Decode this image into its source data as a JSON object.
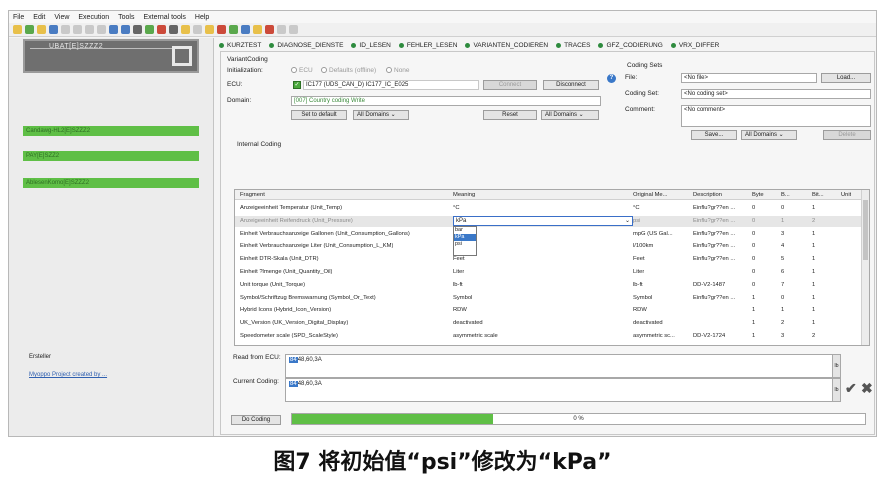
{
  "menu": [
    "File",
    "Edit",
    "View",
    "Execution",
    "Tools",
    "External tools",
    "Help"
  ],
  "left": {
    "ubat_label": "UBAT[E]SZZZ2",
    "green_bars": [
      "Candawg-HL2[E]SZZZ2",
      "PAY[E]SZZ2",
      "AblesenKomo[E]SZZZ2"
    ],
    "ersteller_label": "Ersteller",
    "ersteller_link": "Myoppo Project created by ..."
  },
  "tabs": [
    "KURZTEST",
    "DIAGNOSE_DIENSTE",
    "ID_LESEN",
    "FEHLER_LESEN",
    "VARIANTEN_CODIEREN",
    "TRACES",
    "GFZ_CODIERUNG",
    "VRX_DIFFER"
  ],
  "variant": {
    "section_label": "VariantCoding",
    "init_label": "Initialization:",
    "radio_options": [
      "ECU",
      "Defaults (offline)",
      "None"
    ],
    "ecu_label": "ECU:",
    "ecu_value": "IC177 (UDS_CAN_D) IC177_IC_E025",
    "connect_btn": "Connect",
    "disconnect_btn": "Disconnect",
    "domain_label": "Domain:",
    "domain_value": "[007] Country coding Write",
    "set_default_btn": "Set to default",
    "all_domains_1": "All Domains",
    "reset_btn": "Reset",
    "all_domains_2": "All Domains"
  },
  "coding_sets": {
    "section_label": "Coding Sets",
    "file_label": "File:",
    "file_value": "<No file>",
    "load_btn": "Load...",
    "coding_set_label": "Coding Set:",
    "coding_set_value": "<No coding set>",
    "comment_label": "Comment:",
    "comment_value": "<No comment>",
    "save_btn": "Save...",
    "all_domains": "All Domains",
    "delete_btn": "Delete"
  },
  "internal_coding_label": "Internal Coding",
  "table": {
    "headers": [
      "Fragment",
      "Meaning",
      "Original Me...",
      "Description",
      "Byte",
      "B...",
      "Bit...",
      "Unit"
    ],
    "rows": [
      [
        "Anzeigeeinheit Temperatur (Unit_Temp)",
        "°C",
        "°C",
        "Einflu?gr??en ...",
        "0",
        "0",
        "1",
        ""
      ],
      [
        "Anzeigeeinheit Reifendruck (Unit_Pressure)",
        "kPa",
        "psi",
        "Einflu?gr??en ...",
        "0",
        "1",
        "2",
        ""
      ],
      [
        "Einheit Verbrauchsanzeige Gallonen (Unit_Consumption_Gallons)",
        "",
        "mpG (US Gal...",
        "Einflu?gr??en ...",
        "0",
        "3",
        "1",
        ""
      ],
      [
        "Einheit Verbrauchsanzeige Liter (Unit_Consumption_L_KM)",
        "",
        "l/100km",
        "Einflu?gr??en ...",
        "0",
        "4",
        "1",
        ""
      ],
      [
        "Einheit DTR-Skala (Unit_DTR)",
        "Feet",
        "Feet",
        "Einflu?gr??en ...",
        "0",
        "5",
        "1",
        ""
      ],
      [
        "Einheit ?lmenge (Unit_Quantity_Oil)",
        "Liter",
        "Liter",
        "",
        "0",
        "6",
        "1",
        ""
      ],
      [
        "Unit torque (Unit_Torque)",
        "lb-ft",
        "lb-ft",
        "DD-V2-1487",
        "0",
        "7",
        "1",
        ""
      ],
      [
        "Symbol/Schriftzug Bremswarnung (Symbol_Or_Text)",
        "Symbol",
        "Symbol",
        "Einflu?gr??en ...",
        "1",
        "0",
        "1",
        ""
      ],
      [
        "Hybrid Icons (Hybrid_Icon_Version)",
        "RDW",
        "RDW",
        "",
        "1",
        "1",
        "1",
        ""
      ],
      [
        "UK_Version (UK_Version_Digital_Display)",
        "deactivated",
        "deactivated",
        "",
        "1",
        "2",
        "1",
        ""
      ],
      [
        "Speedometer scale (SPD_ScaleStyle)",
        "asymmetric scale",
        "asymmetric sc...",
        "DD-V2-1724",
        "1",
        "3",
        "2",
        ""
      ]
    ],
    "dropdown_value": "kPa",
    "dropdown_options": [
      "bar",
      "kPa",
      "psi"
    ]
  },
  "read_label": "Read from ECU:",
  "read_hex_hi": "84",
  "read_hex": "48,60,3A",
  "current_label": "Current Coding:",
  "current_hex_hi": "84",
  "current_hex": "48,60,3A",
  "do_coding_btn": "Do Coding",
  "progress_text": "0 %",
  "progress_value": 0.35,
  "caption": "图7 将初始值“psi”修改为“kPa”",
  "colors": {
    "green": "#5fbf46",
    "select_blue": "#3a78c8",
    "tab_dot": "#2e8b3e"
  }
}
